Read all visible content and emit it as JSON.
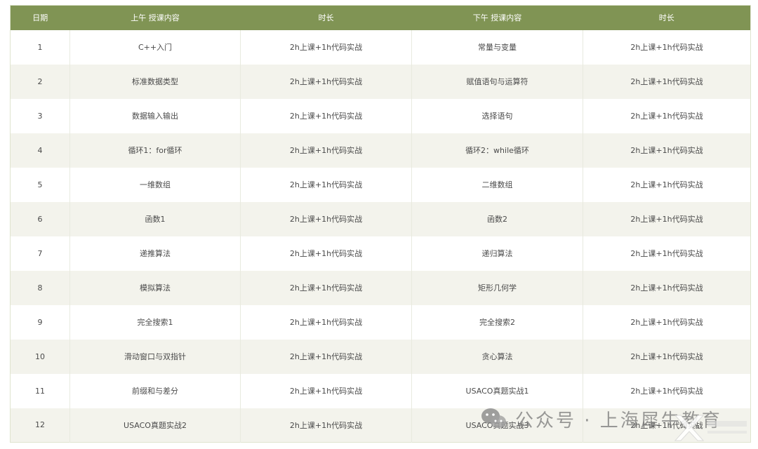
{
  "table": {
    "headers": [
      "日期",
      "上午 授课内容",
      "时长",
      "下午 授课内容",
      "时长"
    ],
    "rows": [
      [
        "1",
        "C++入门",
        "2h上课+1h代码实战",
        "常量与变量",
        "2h上课+1h代码实战"
      ],
      [
        "2",
        "标准数据类型",
        "2h上课+1h代码实战",
        "赋值语句与运算符",
        "2h上课+1h代码实战"
      ],
      [
        "3",
        "数据输入输出",
        "2h上课+1h代码实战",
        "选择语句",
        "2h上课+1h代码实战"
      ],
      [
        "4",
        "循环1：for循环",
        "2h上课+1h代码实战",
        "循环2：while循环",
        "2h上课+1h代码实战"
      ],
      [
        "5",
        "一维数组",
        "2h上课+1h代码实战",
        "二维数组",
        "2h上课+1h代码实战"
      ],
      [
        "6",
        "函数1",
        "2h上课+1h代码实战",
        "函数2",
        "2h上课+1h代码实战"
      ],
      [
        "7",
        "递推算法",
        "2h上课+1h代码实战",
        "递归算法",
        "2h上课+1h代码实战"
      ],
      [
        "8",
        "模拟算法",
        "2h上课+1h代码实战",
        "矩形几何学",
        "2h上课+1h代码实战"
      ],
      [
        "9",
        "完全搜索1",
        "2h上课+1h代码实战",
        "完全搜索2",
        "2h上课+1h代码实战"
      ],
      [
        "10",
        "滑动窗口与双指针",
        "2h上课+1h代码实战",
        "贪心算法",
        "2h上课+1h代码实战"
      ],
      [
        "11",
        "前缀和与差分",
        "2h上课+1h代码实战",
        "USACO真题实战1",
        "2h上课+1h代码实战"
      ],
      [
        "12",
        "USACO真题实战2",
        "2h上课+1h代码实战",
        "USACO真题实战3",
        "2h上课+1h代码实战"
      ]
    ]
  },
  "watermark": {
    "text": "公众号 · 上海犀牛教育",
    "icon": "wechat-icon"
  },
  "logo": {
    "icon": "x-logo-mark"
  },
  "colors": {
    "header_bg": "#809454",
    "row_alt_bg": "#f3f3ec"
  }
}
